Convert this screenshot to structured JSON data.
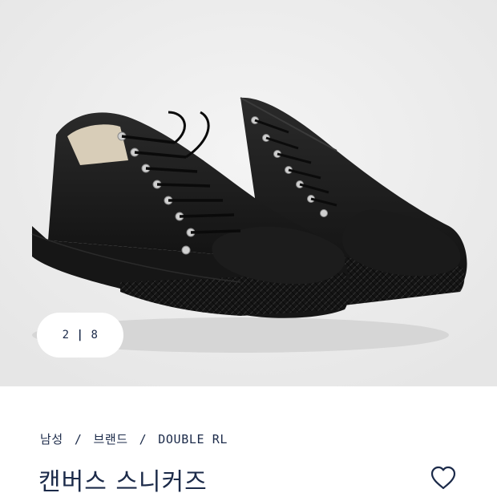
{
  "gallery": {
    "image_alt": "black canvas low-top sneakers",
    "current_index": "2",
    "separator": "|",
    "total": "8"
  },
  "breadcrumb": {
    "items": [
      "남성",
      "브랜드",
      "DOUBLE RL"
    ],
    "separator": "/"
  },
  "product": {
    "title": "캔버스 스니커즈"
  },
  "wishlist": {
    "icon": "heart-icon"
  }
}
